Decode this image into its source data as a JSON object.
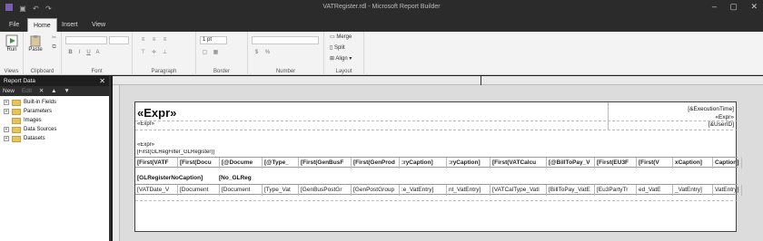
{
  "window": {
    "title": "VATRegister.rdl - Microsoft Report Builder",
    "controls": [
      "–",
      "▢",
      "✕"
    ]
  },
  "tabs": [
    "File",
    "Home",
    "Insert",
    "View"
  ],
  "ribbon": {
    "run": "Run",
    "paste": "Paste",
    "font_size": "1 pt",
    "merge": "Merge",
    "split": "Split",
    "align": "Align",
    "groups": {
      "views": "Views",
      "clipboard": "Clipboard",
      "font": "Font",
      "paragraph": "Paragraph",
      "border": "Border",
      "number": "Number",
      "layout": "Layout"
    }
  },
  "report_data": {
    "header": "Report Data",
    "new_label": "New",
    "edit_label": "Edit",
    "items": [
      "Built-in Fields",
      "Parameters",
      "Images",
      "Data Sources",
      "Datasets"
    ]
  },
  "report": {
    "expr_big": "«Expr»",
    "execution_time": "[&ExecutionTime]",
    "expr_right": "«Expr»",
    "user_id": "[&UserID]",
    "expr_small": "«Expr»",
    "expr_small2": "«Expr»",
    "filter": "[First(GLRegFilter_GLRegister)]",
    "columns": [
      "[First(VATF",
      "[First(Docu",
      "[@Docume",
      "[@Type_",
      "[First(GenBusF",
      "[First(GenProd",
      ":ryCaption]",
      ":ryCaption]",
      "[First(VATCalcu",
      "[@BillToPay_V",
      "[First(EU3F",
      "[First(V",
      "xCaption]",
      "Caption]"
    ],
    "group_caption": "[GLRegisterNoCaption]",
    "group_no": "[No_GLReg",
    "details": [
      "[VATDate_V",
      "[Document",
      "[Document",
      "[Type_Vat",
      "[GenBusPostGr",
      "[GenPostGroup",
      ":e_VatEntry]",
      "nt_VatEntry]",
      "[VATCalType_Vatl",
      "[BillToPay_VatE",
      "[Eu3PartyTr",
      "ed_VatE",
      "_VatEntry]",
      "VatEntry]"
    ]
  }
}
